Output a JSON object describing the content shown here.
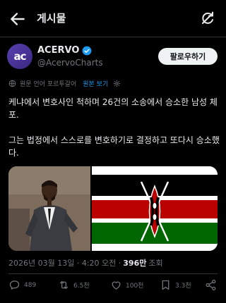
{
  "header": {
    "title": "게시물"
  },
  "author": {
    "avatar_text": "ac",
    "display_name": "ACERVO",
    "handle": "@AcervoCharts",
    "follow_label": "팔로우하기"
  },
  "translation": {
    "label": "원문 언어 포르투갈어",
    "link": "원본 보기"
  },
  "tweet": {
    "text": "케냐에서 변호사인 척하며 26건의 소송에서 승소한 남성 체포.\n\n그는 법정에서 스스로를 변호하기로 결정하고 또다시 승소했다."
  },
  "meta": {
    "timestamp": "2026년 03월 13일 · 4:20 오전 ·",
    "views": "396만",
    "views_label": "조회"
  },
  "actions": {
    "replies": "489",
    "reposts": "6.5천",
    "likes": "100천",
    "bookmarks": "3.3천"
  },
  "colors": {
    "accent": "#1d9bf0",
    "flag_black": "#000000",
    "flag_red": "#bb0000",
    "flag_green": "#006600"
  }
}
